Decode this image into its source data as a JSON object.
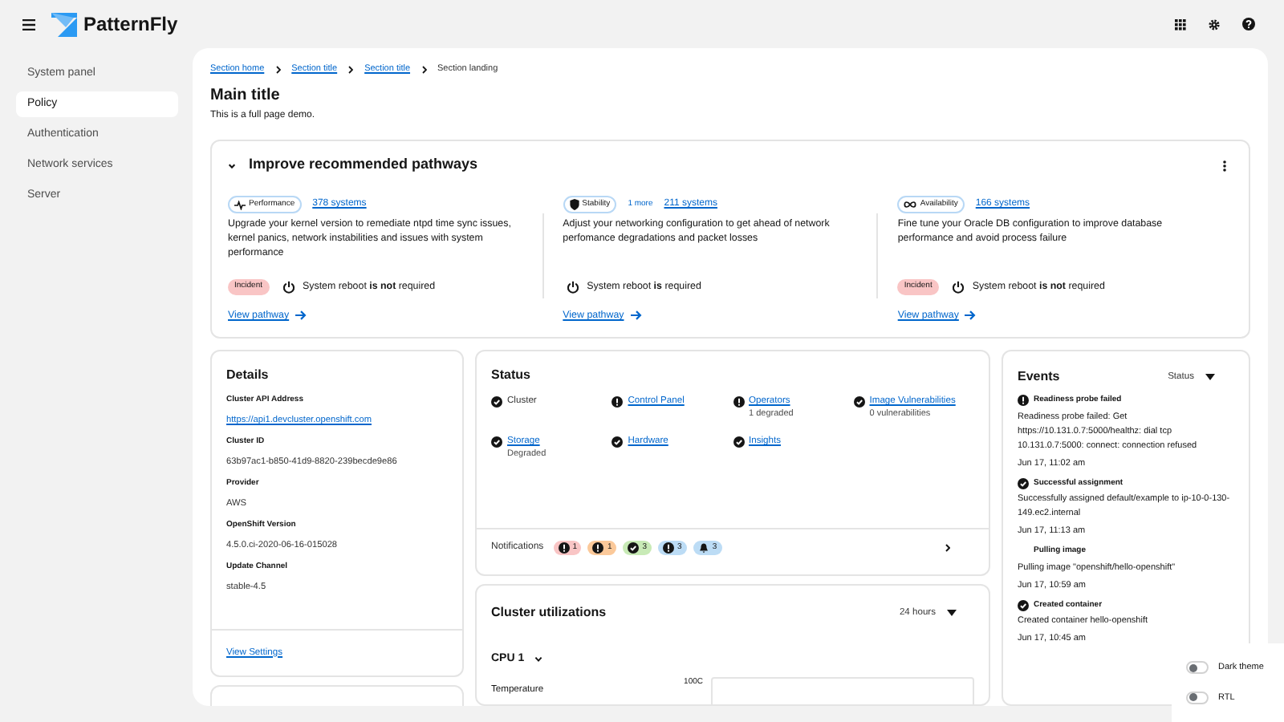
{
  "header": {
    "brand": "PatternFly"
  },
  "sidebar": {
    "items": [
      {
        "label": "System panel",
        "selected": false
      },
      {
        "label": "Policy",
        "selected": true
      },
      {
        "label": "Authentication",
        "selected": false
      },
      {
        "label": "Network services",
        "selected": false
      },
      {
        "label": "Server",
        "selected": false
      }
    ]
  },
  "breadcrumb": [
    {
      "label": "Section home",
      "link": true
    },
    {
      "label": "Section title",
      "link": true
    },
    {
      "label": "Section title",
      "link": true
    },
    {
      "label": "Section landing",
      "link": false
    }
  ],
  "page": {
    "title": "Main title",
    "subtitle": "This is a full page demo."
  },
  "pathways": {
    "title": "Improve recommended pathways",
    "expanded": true,
    "items": [
      {
        "tag": "Performance",
        "kind": "performance",
        "systems": "378 systems",
        "description": "Upgrade your kernel version to remediate ntpd time sync issues, kernel panics, network instabilities and issues with system performance",
        "incident": "Incident",
        "reboot": "System reboot **is not** required",
        "link": "View pathway"
      },
      {
        "tag": "Stability",
        "kind": "stability",
        "more": "1 more",
        "systems": "211 systems",
        "description": "Adjust your networking configuration to get ahead of network perfomance degradations and packet losses",
        "reboot": "System reboot **is** required",
        "link": "View pathway"
      },
      {
        "tag": "Availability",
        "kind": "availability",
        "systems": "166 systems",
        "description": "Fine tune your Oracle DB configuration to improve database performance and avoid process failure",
        "incident": "Incident",
        "reboot": "System reboot **is not** required",
        "link": "View pathway"
      }
    ]
  },
  "details": {
    "title": "Details",
    "fields": [
      {
        "label": "Cluster API Address",
        "value": "https://api1.devcluster.openshift.com",
        "link": true
      },
      {
        "label": "Cluster ID",
        "value": "63b97ac1-b850-41d9-8820-239becde9e86",
        "link": false
      },
      {
        "label": "Provider",
        "value": "AWS",
        "link": false
      },
      {
        "label": "OpenShift Version",
        "value": "4.5.0.ci-2020-06-16-015028",
        "link": false
      },
      {
        "label": "Update Channel",
        "value": "stable-4.5",
        "link": false
      }
    ],
    "footer_link": "View Settings"
  },
  "status": {
    "title": "Status",
    "items": [
      {
        "label": "Cluster",
        "kind": "success",
        "link": false
      },
      {
        "label": "Control Panel",
        "kind": "error",
        "link": true
      },
      {
        "label": "Operators",
        "kind": "error",
        "link": true,
        "detail": "1 degraded"
      },
      {
        "label": "Image Vulnerabilities",
        "kind": "success",
        "link": true,
        "detail": "0 vulnerabilities"
      },
      {
        "label": "Storage",
        "kind": "success",
        "link": true,
        "detail": "Degraded"
      },
      {
        "label": "Hardware",
        "kind": "success",
        "link": true
      },
      {
        "label": "Insights",
        "kind": "success",
        "link": true
      }
    ],
    "notifications": {
      "label": "Notifications",
      "badges": [
        {
          "count": "1",
          "kind": "error",
          "color": "#f9c5c5"
        },
        {
          "count": "1",
          "kind": "error",
          "color": "#fbc99a"
        },
        {
          "count": "3",
          "kind": "success",
          "color": "#c8eab6"
        },
        {
          "count": "3",
          "kind": "error",
          "color": "#bcdcf5"
        },
        {
          "count": "3",
          "kind": "bell",
          "color": "#bcdcf5"
        }
      ]
    }
  },
  "utilization": {
    "title": "Cluster utilizations",
    "range": "24 hours",
    "metric": "CPU 1",
    "row_label": "Temperature",
    "tick": "100C"
  },
  "events": {
    "title": "Events",
    "filter": "Status",
    "items": [
      {
        "title": "Readiness probe failed",
        "kind": "error",
        "message": "Readiness probe failed: Get https://10.131.0.7:5000/healthz: dial tcp 10.131.0.7:5000: connect: connection refused",
        "time": "Jun 17, 11:02 am"
      },
      {
        "title": "Successful assignment",
        "kind": "success",
        "message": "Successfully assigned default/example to ip-10-0-130-149.ec2.internal",
        "time": "Jun 17, 11:13 am"
      },
      {
        "title": "Pulling image",
        "kind": "none",
        "message": "Pulling image \"openshift/hello-openshift\"",
        "time": "Jun 17, 10:59 am"
      },
      {
        "title": "Created container",
        "kind": "success",
        "message": "Created container hello-openshift",
        "time": "Jun 17, 10:45 am"
      }
    ]
  },
  "toggles": [
    {
      "label": "Dark theme",
      "on": false
    },
    {
      "label": "RTL",
      "on": false
    }
  ]
}
